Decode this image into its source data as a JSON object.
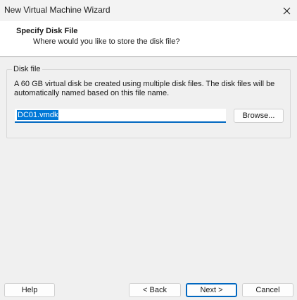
{
  "window": {
    "title": "New Virtual Machine Wizard",
    "close_icon": "close-icon"
  },
  "header": {
    "title": "Specify Disk File",
    "subtitle": "Where would you like to store the disk file?"
  },
  "disk_file": {
    "legend": "Disk file",
    "description": "A 60 GB virtual disk be created using multiple disk files. The disk files will be automatically named based on this file name.",
    "file_name": "DC01.vmdk",
    "browse_label": "Browse..."
  },
  "footer": {
    "help_label": "Help",
    "back_label": "< Back",
    "next_label": "Next >",
    "cancel_label": "Cancel"
  },
  "colors": {
    "accent": "#0067c0",
    "selection": "#0078d7"
  }
}
